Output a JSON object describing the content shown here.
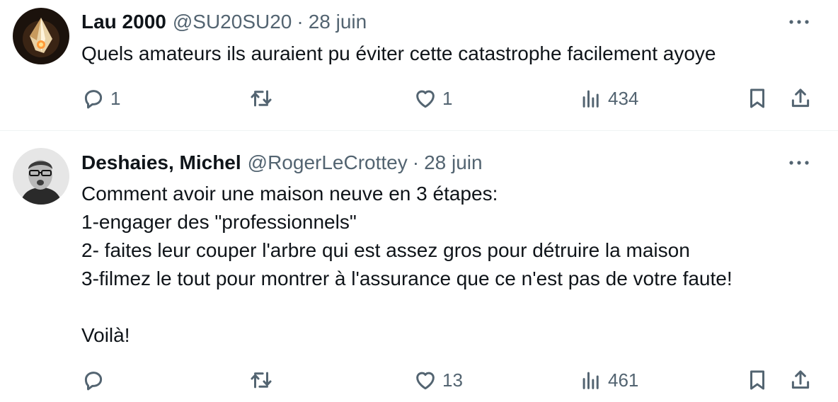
{
  "tweets": [
    {
      "author_name": "Lau 2000",
      "handle": "@SU20SU20",
      "separator": "·",
      "date": "28 juin",
      "text": "Quels amateurs ils auraient pu éviter cette catastrophe facilement ayoye",
      "replies": "1",
      "retweets": "",
      "likes": "1",
      "views": "434"
    },
    {
      "author_name": "Deshaies, Michel",
      "handle": "@RogerLeCrottey",
      "separator": "·",
      "date": "28 juin",
      "text": "Comment avoir une maison neuve en 3 étapes:\n1-engager des \"professionnels\"\n2- faites leur couper l'arbre qui est assez gros pour détruire la maison\n3-filmez le tout pour montrer à l'assurance que ce n'est pas de votre faute!\n\nVoilà!",
      "replies": "",
      "retweets": "",
      "likes": "13",
      "views": "461"
    }
  ],
  "icons": {
    "more": "more-icon",
    "reply": "reply-icon",
    "retweet": "retweet-icon",
    "like": "like-icon",
    "views": "views-icon",
    "bookmark": "bookmark-icon",
    "share": "share-icon"
  },
  "colors": {
    "text_primary": "#0f1419",
    "text_secondary": "#536471",
    "divider": "#eff3f4"
  }
}
